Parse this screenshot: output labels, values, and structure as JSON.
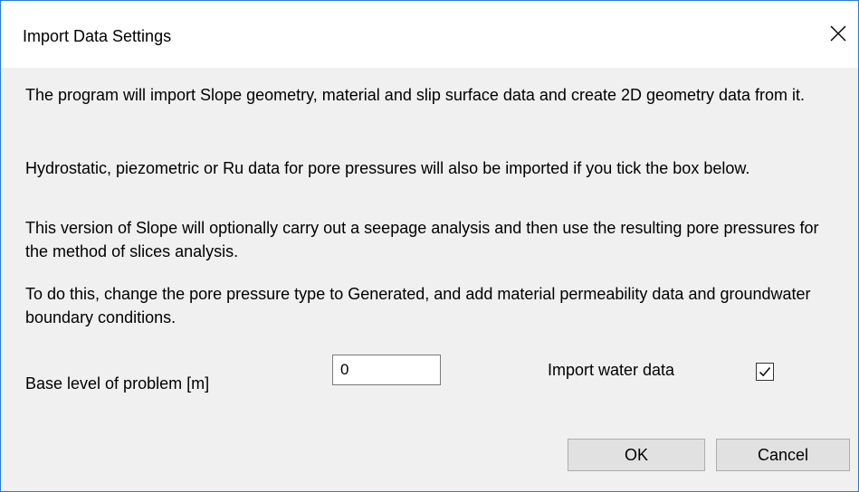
{
  "dialog": {
    "title": "Import Data Settings",
    "close_icon": "close-icon"
  },
  "body": {
    "paragraphs": [
      "The program will import Slope geometry, material and slip surface data and create 2D geometry data from it.",
      "Hydrostatic, piezometric or Ru data for pore pressures will also be imported if you tick the box below.",
      "This version of Slope will optionally carry out a seepage analysis and then use the resulting pore pressures for the method of slices analysis.",
      "To do this, change the pore pressure type to Generated, and add material permeability data and groundwater boundary conditions."
    ]
  },
  "form": {
    "base_level_label": "Base level of problem [m]",
    "base_level_value": "0",
    "import_water_label": "Import water data",
    "import_water_checked": true
  },
  "buttons": {
    "ok_label": "OK",
    "cancel_label": "Cancel"
  },
  "colors": {
    "window_border": "#2b79d9",
    "dialog_background": "#f0f0f0",
    "titlebar_background": "#ffffff",
    "button_face": "#e1e1e1"
  }
}
